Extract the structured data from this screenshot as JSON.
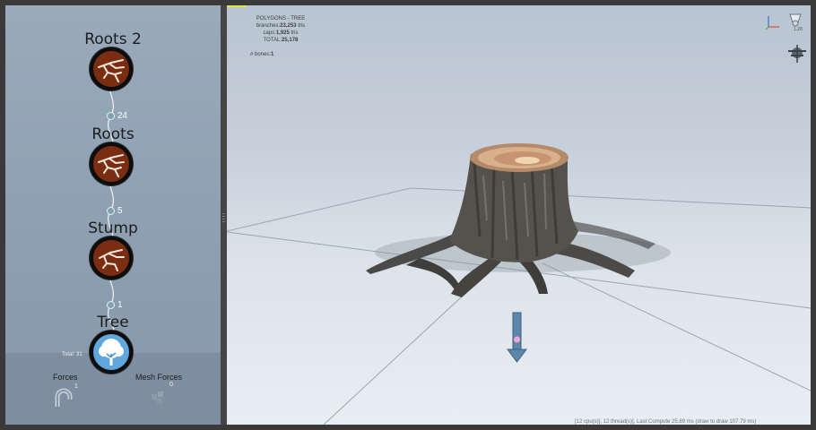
{
  "node_tree": {
    "nodes": [
      {
        "title": "Roots 2",
        "icon": "roots-icon"
      },
      {
        "title": "Roots",
        "icon": "roots-icon"
      },
      {
        "title": "Stump",
        "icon": "stump-icon"
      },
      {
        "title": "Tree",
        "icon": "tree-icon"
      }
    ],
    "connections": [
      "24",
      "5",
      "1"
    ],
    "total_label": "Total: 31",
    "forces": {
      "label": "Forces",
      "count": "1",
      "icon": "magnet-icon"
    },
    "mesh_forces": {
      "label": "Mesh Forces",
      "count": "0",
      "icon": "mesh-forces-icon"
    }
  },
  "viewport": {
    "stats": {
      "header": "POLYGONS - TREE",
      "branches_label": "branches:",
      "branches_value": "23,253",
      "branches_unit": "tris",
      "caps_label": "caps:",
      "caps_value": "1,925",
      "caps_unit": "tris",
      "total_label": "TOTAL:",
      "total_value": "25,178"
    },
    "bones_label": "# bones:",
    "bones_value": "1",
    "zoom_value": "1.28",
    "status_bar": "[12 cpu(s)], 12 thread(s)], Last Compute 25.89 ms (draw to draw 107.79 ms)",
    "icons": [
      "axis-gizmo-icon",
      "light-icon",
      "wind-icon",
      "wind-direction-arrow-icon"
    ]
  },
  "colors": {
    "node_root_fill": "#7b2d12",
    "node_tree_fill": "#5fa7dd",
    "panel_bg": "#8c9eb0",
    "viewport_bg": "#c7d1dc",
    "wind_arrow": "#5d86aa"
  }
}
